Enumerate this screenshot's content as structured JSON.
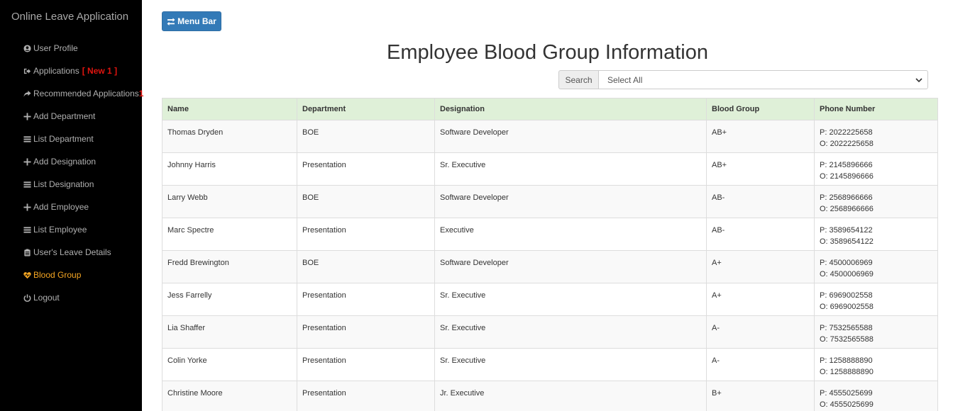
{
  "sidebar": {
    "brand": "Online Leave Application",
    "items": [
      {
        "label": "User Profile",
        "icon": "user-icon"
      },
      {
        "label": "Applications",
        "icon": "sign-in-icon",
        "badge": "[ New 1 ]"
      },
      {
        "label": "Recommended Applications",
        "icon": "share-icon",
        "badge": "1"
      },
      {
        "label": "Add Department",
        "icon": "plus-icon"
      },
      {
        "label": "List Department",
        "icon": "list-icon"
      },
      {
        "label": "Add Designation",
        "icon": "plus-icon"
      },
      {
        "label": "List Designation",
        "icon": "list-icon"
      },
      {
        "label": "Add Employee",
        "icon": "plus-icon"
      },
      {
        "label": "List Employee",
        "icon": "list-icon"
      },
      {
        "label": "User's Leave Details",
        "icon": "clipboard-icon"
      },
      {
        "label": "Blood Group",
        "icon": "heart-icon",
        "active": true
      },
      {
        "label": "Logout",
        "icon": "power-icon"
      }
    ]
  },
  "toolbar": {
    "menu_label": "Menu Bar"
  },
  "page": {
    "title": "Employee Blood Group Information"
  },
  "search": {
    "addon": "Search",
    "selected": "Select All"
  },
  "table": {
    "headers": [
      "Name",
      "Department",
      "Designation",
      "Blood Group",
      "Phone Number"
    ],
    "rows": [
      {
        "name": "Thomas Dryden",
        "department": "BOE",
        "designation": "Software Developer",
        "blood": "AB+",
        "phone_p": "P: 2022225658",
        "phone_o": "O: 2022225658"
      },
      {
        "name": "Johnny Harris",
        "department": "Presentation",
        "designation": "Sr. Executive",
        "blood": "AB+",
        "phone_p": "P: 2145896666",
        "phone_o": "O: 2145896666"
      },
      {
        "name": "Larry Webb",
        "department": "BOE",
        "designation": "Software Developer",
        "blood": "AB-",
        "phone_p": "P: 2568966666",
        "phone_o": "O: 2568966666"
      },
      {
        "name": "Marc Spectre",
        "department": "Presentation",
        "designation": "Executive",
        "blood": "AB-",
        "phone_p": "P: 3589654122",
        "phone_o": "O: 3589654122"
      },
      {
        "name": "Fredd Brewington",
        "department": "BOE",
        "designation": "Software Developer",
        "blood": "A+",
        "phone_p": "P: 4500006969",
        "phone_o": "O: 4500006969"
      },
      {
        "name": "Jess Farrelly",
        "department": "Presentation",
        "designation": "Sr. Executive",
        "blood": "A+",
        "phone_p": "P: 6969002558",
        "phone_o": "O: 6969002558"
      },
      {
        "name": "Lia Shaffer",
        "department": "Presentation",
        "designation": "Sr. Executive",
        "blood": "A-",
        "phone_p": "P: 7532565588",
        "phone_o": "O: 7532565588"
      },
      {
        "name": "Colin Yorke",
        "department": "Presentation",
        "designation": "Sr. Executive",
        "blood": "A-",
        "phone_p": "P: 1258888890",
        "phone_o": "O: 1258888890"
      },
      {
        "name": "Christine Moore",
        "department": "Presentation",
        "designation": "Jr. Executive",
        "blood": "B+",
        "phone_p": "P: 4555025699",
        "phone_o": "O: 4555025699"
      }
    ]
  }
}
